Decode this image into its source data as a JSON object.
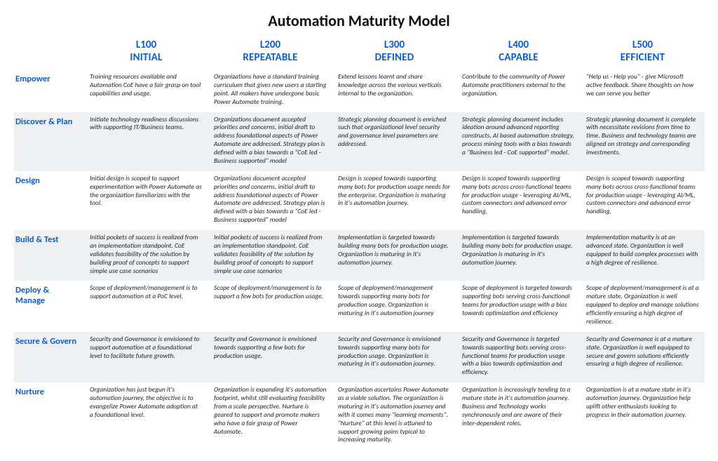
{
  "title": "Automation Maturity Model",
  "levels": [
    {
      "code": "L100",
      "name": "INITIAL"
    },
    {
      "code": "L200",
      "name": "REPEATABLE"
    },
    {
      "code": "L300",
      "name": "DEFINED"
    },
    {
      "code": "L400",
      "name": "CAPABLE"
    },
    {
      "code": "L500",
      "name": "EFFICIENT"
    }
  ],
  "rows": [
    {
      "label": "Empower",
      "cells": [
        "Training resources available and Automation CoE have a fair grasp on tool capabilities and usage.",
        "Organizations have a standard training curriculum that gives new users a starting point. All makers have undergone basic Power Automate training.",
        "Extend lessons learnt and share knowledge across the various verticals internal to the organization.",
        "Contribute to the community of Power Automate practitioners external to the organization.",
        "\"Help us - Help you\" - give Microsoft active feedback. Share thoughts on how we can serve you better"
      ]
    },
    {
      "label": "Discover & Plan",
      "cells": [
        "Initiate technology readiness discussions with supporting IT/Business teams.",
        "Organizations document accepted priorities and concerns, initial draft to address foundational aspects of Power Automate are addressed. Strategy plan is defined with a bias towards a \"CoE led - Business supported\" model",
        "Strategic planning document is enriched such that organizational level security and governance level parameters are addressed.",
        "Strategic planning document includes ideation around advanced reporting constructs, AI based automation strategy, process mining tools with a bias towards a \"Business led - CoE supported\" model.",
        "Strategic planning document is complete with necessitate revisions from time to time. Business and technology teams are aligned on strategy and corresponding investments."
      ]
    },
    {
      "label": "Design",
      "cells": [
        "Initial design is scoped to support experimentation with Power Automate as the organization familiarizes with the tool.",
        "Organizations document accepted priorities and concerns, initial draft to address foundational aspects of Power Automate are addressed. Strategy plan is defined with a bias towards a \"CoE led - Business supported\" model",
        "Design is scoped towards supporting many bots for production usage needs for the enterprise. Organization is maturing in it's automation journey.",
        "Design is scoped towards supporting many bots across cross-functional teams for production usage - leveraging AI/ML, custom connectors and advanced error handling.",
        "Design is scoped towards supporting many bots across cross-functional teams for production usage - leveraging AI/ML, custom connectors and advanced error handling."
      ]
    },
    {
      "label": "Build & Test",
      "cells": [
        "Initial pockets of success is realized from an implementation standpoint. CoE validates feasibility of the solution by building proof of concepts to support simple use case scenarios",
        "Initial pockets of success is realized from an implementation standpoint. CoE validates feasibility of the solution by building proof of concepts to support simple use case scenarios",
        "Implementation is targeted towards building many bots for production usage. Organization is maturing in it's automation journey.",
        "Implementation is targeted towards building many bots for production usage. Organization is maturing in it's automation journey.",
        "Implementation maturity is at an advanced state. Organization is well equipped to build complex processes with a high degree of resilience."
      ]
    },
    {
      "label": "Deploy & Manage",
      "cells": [
        "Scope of deployment/management is to support automation at a PoC level.",
        "Scope of deployment/management is to support a few bots for production usage.",
        "Scope of deployment/management towards supporting many bots for production usage. Organization is maturing in it's automation journey",
        "Scope of deployment is targeted towards supporting bots serving cross-functional teams for production usage with a bias towards optimization and efficiency",
        "Scope of deployment/management is at a mature state. Organization is well equipped to deploy and manage solutions efficiently ensuring a high degree of resilience."
      ]
    },
    {
      "label": "Secure & Govern",
      "cells": [
        "Security and Governance is envisioned to support automation at a foundational level to facilitate future growth.",
        "Security and Governance is envisioned towards supporting a few bots for production usage.",
        "Security and Governance is envisioned towards supporting many bots for production usage. Organization is maturing in it's automation journey.",
        "Security and Governance is targeted towards supporting bots serving cross-functional teams for production usage with a bias towards optimization and efficiency.",
        "Security and Governance is at a mature state. Organization is well equipped to secure and govern solutions efficiently ensuring a high degree of resilience."
      ]
    },
    {
      "label": "Nurture",
      "cells": [
        "Organization has just begun it's automation journey, the objective is to evangelize Power Automate adoption at a foundational level.",
        "Organization is expanding it's automation footprint, whilst still evaluating feasibility from a scale perspective. Nurture is geared to support and promote makers who have a fair grasp of Power Automate.",
        "Organization ascertains Power Automate as a viable solution. The organization is maturing in it's automation journey and with it comes many \"learning moments\". \"Nurture\" at this level is attuned to support growing pains typical to increasing maturity.",
        "Organization is increasingly tending to a mature state in it's automation journey. Business and Technology works synchronously and are aware of their inter-dependent roles.",
        "Organization is at a mature state in it's automation journey. Organization help uplift other enthusiasts looking to progress in their automation journey."
      ]
    }
  ]
}
